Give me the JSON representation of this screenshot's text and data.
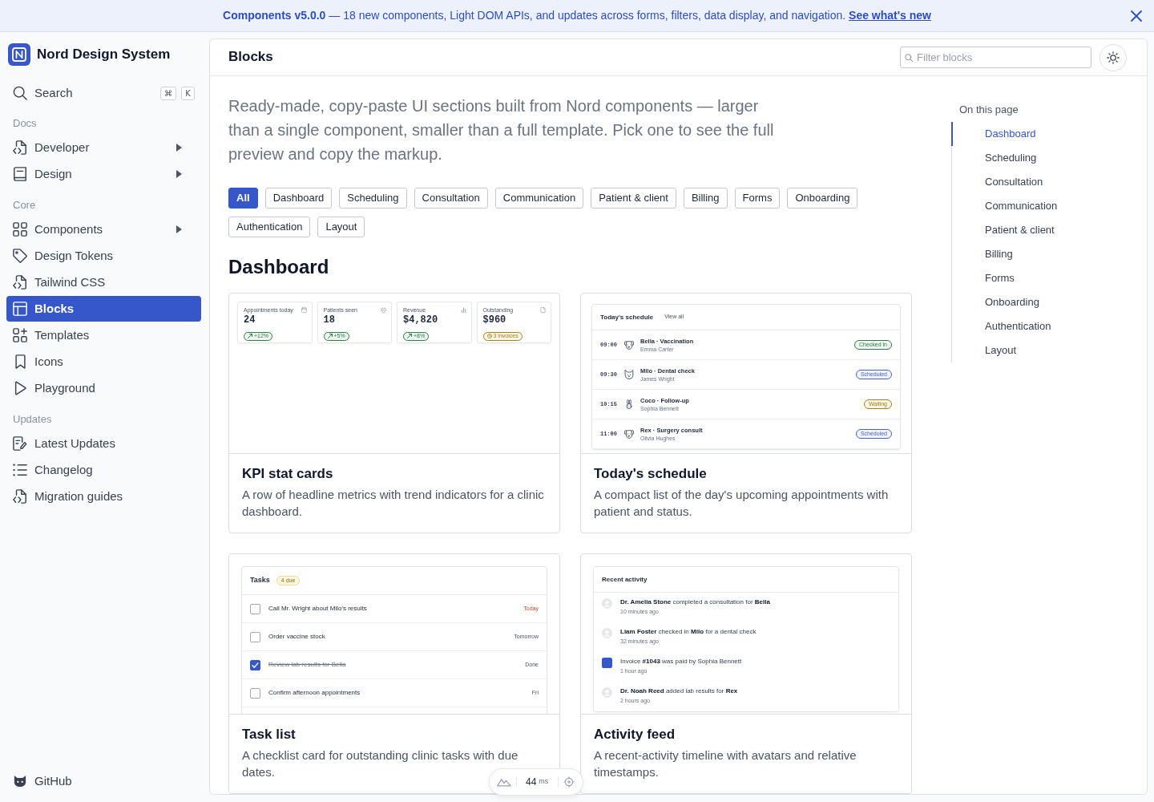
{
  "banner": {
    "message": "**Components v5.0.0** — 18 new components, Light DOM APIs, and updates across forms, filters, data display, and navigation.",
    "link": "See what's new"
  },
  "sidebar": {
    "brand": "Nord Design System",
    "search": {
      "label": "Search",
      "shortcut": [
        "⌘",
        "K"
      ]
    },
    "sections": [
      {
        "heading": "Docs",
        "items": [
          {
            "label": "Developer",
            "expandable": true,
            "selected": false
          },
          {
            "label": "Design",
            "expandable": true,
            "selected": false
          }
        ]
      },
      {
        "heading": "Core",
        "items": [
          {
            "label": "Components",
            "expandable": true,
            "selected": false
          },
          {
            "label": "Design Tokens",
            "expandable": false,
            "selected": false
          },
          {
            "label": "Tailwind CSS",
            "expandable": false,
            "selected": false
          },
          {
            "label": "Blocks",
            "expandable": false,
            "selected": true
          },
          {
            "label": "Templates",
            "expandable": false,
            "selected": false
          },
          {
            "label": "Icons",
            "expandable": false,
            "selected": false
          },
          {
            "label": "Playground",
            "expandable": false,
            "selected": false
          }
        ]
      },
      {
        "heading": "Updates",
        "items": [
          {
            "label": "Latest Updates",
            "expandable": false,
            "selected": false
          },
          {
            "label": "Changelog",
            "expandable": false,
            "selected": false
          },
          {
            "label": "Migration guides",
            "expandable": false,
            "selected": false
          }
        ]
      }
    ],
    "footer_link": "GitHub"
  },
  "main": {
    "title": "Blocks",
    "filter_placeholder": "Filter blocks",
    "intro": "Ready-made, copy-paste UI sections built from Nord components — larger than a single component, smaller than a full template. Pick one to see the full preview and copy the markup.",
    "filters": [
      {
        "label": "All",
        "selected": true
      },
      {
        "label": "Dashboard",
        "selected": false
      },
      {
        "label": "Scheduling",
        "selected": false
      },
      {
        "label": "Consultation",
        "selected": false
      },
      {
        "label": "Communication",
        "selected": false
      },
      {
        "label": "Patient & client",
        "selected": false
      },
      {
        "label": "Billing",
        "selected": false
      },
      {
        "label": "Forms",
        "selected": false
      },
      {
        "label": "Onboarding",
        "selected": false
      },
      {
        "label": "Authentication",
        "selected": false
      },
      {
        "label": "Layout",
        "selected": false
      }
    ],
    "section_heading": "Dashboard",
    "blocks": [
      {
        "title": "KPI stat cards",
        "description": "A row of headline metrics with trend indicators for a clinic dashboard.",
        "preview": {
          "kind": "stats",
          "cards": [
            {
              "label": "Appointments today",
              "value": "24",
              "trend": "+12%",
              "color": "#2e7d46"
            },
            {
              "label": "Patients seen",
              "value": "18",
              "trend": "+5%",
              "color": "#2e7d46"
            },
            {
              "label": "Revenue",
              "value": "$4,820",
              "trend": "+8%",
              "color": "#2e7d46"
            },
            {
              "label": "Outstanding",
              "value": "$960",
              "trend": "3 invoices",
              "color": "#a3820f"
            }
          ]
        }
      },
      {
        "title": "Today's schedule",
        "description": "A compact list of the day's upcoming appointments with patient and status.",
        "preview": {
          "kind": "schedule",
          "title": "Today's schedule",
          "link": "View all",
          "rows": [
            {
              "time": "09:00",
              "title": "Bella · Vaccination",
              "owner": "Emma Carter",
              "status": "Checked in",
              "color": "#2e7d46"
            },
            {
              "time": "09:30",
              "title": "Milo · Dental check",
              "owner": "James Wright",
              "status": "Scheduled",
              "color": "#4a63c9"
            },
            {
              "time": "10:15",
              "title": "Coco · Follow-up",
              "owner": "Sophia Bennett",
              "status": "Waiting",
              "color": "#a3820f"
            },
            {
              "time": "11:00",
              "title": "Rex · Surgery consult",
              "owner": "Olivia Hughes",
              "status": "Scheduled",
              "color": "#4a63c9"
            }
          ]
        }
      },
      {
        "title": "Task list",
        "description": "A checklist card for outstanding clinic tasks with due dates.",
        "preview": {
          "kind": "tasks",
          "title": "Tasks",
          "badge": "4 due",
          "items": [
            {
              "label": "Call Mr. Wright about Milo's results",
              "due": "Today",
              "checked": false,
              "urgent": true
            },
            {
              "label": "Order vaccine stock",
              "due": "Tomorrow",
              "checked": false,
              "urgent": false
            },
            {
              "label": "Review lab results for Bella",
              "due": "Done",
              "checked": true,
              "urgent": false
            },
            {
              "label": "Confirm afternoon appointments",
              "due": "Fri",
              "checked": false,
              "urgent": false
            }
          ]
        }
      },
      {
        "title": "Activity feed",
        "description": "A recent-activity timeline with avatars and relative timestamps.",
        "preview": {
          "kind": "activity",
          "title": "Recent activity",
          "items": [
            {
              "kind": "person",
              "text": "**Dr. Amelia Stone** completed a consultation for **Bella**",
              "time": "10 minutes ago"
            },
            {
              "kind": "person",
              "text": "**Liam Foster** checked in **Milo** for a dental check",
              "time": "32 minutes ago"
            },
            {
              "kind": "payment",
              "text": "Invoice **#1043** was paid by Sophia Bennett",
              "time": "1 hour ago"
            },
            {
              "kind": "person",
              "text": "**Dr. Noah Reed** added lab results for **Rex**",
              "time": "2 hours ago"
            }
          ]
        }
      }
    ]
  },
  "toc": {
    "heading": "On this page",
    "items": [
      {
        "label": "Dashboard",
        "selected": true
      },
      {
        "label": "Scheduling",
        "selected": false
      },
      {
        "label": "Consultation",
        "selected": false
      },
      {
        "label": "Communication",
        "selected": false
      },
      {
        "label": "Patient & client",
        "selected": false
      },
      {
        "label": "Billing",
        "selected": false
      },
      {
        "label": "Forms",
        "selected": false
      },
      {
        "label": "Onboarding",
        "selected": false
      },
      {
        "label": "Authentication",
        "selected": false
      },
      {
        "label": "Layout",
        "selected": false
      }
    ]
  },
  "perf_toolbar": {
    "value": "44",
    "unit": "ms"
  }
}
